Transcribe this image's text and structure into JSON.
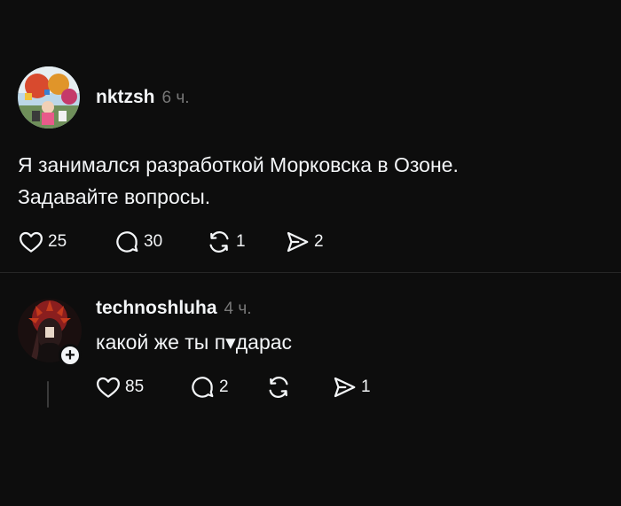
{
  "post": {
    "username": "nktzsh",
    "time": "6 ч.",
    "text_lines": [
      "Я занимался разработкой Морковска в Озоне.",
      "Задавайте вопросы."
    ],
    "likes": "25",
    "comments": "30",
    "reposts": "1",
    "shares": "2"
  },
  "reply": {
    "username": "technoshluha",
    "time": "4 ч.",
    "text": "какой же ты п▾дарас",
    "likes": "85",
    "comments": "2",
    "reposts": "",
    "shares": "1",
    "follow_symbol": "+"
  },
  "icons": {
    "like": "heart-icon",
    "comment": "comment-bubble-icon",
    "repost": "repost-icon",
    "share": "send-icon"
  },
  "colors": {
    "background": "#0d0d0d",
    "text": "#f3f5f7",
    "muted": "#777777",
    "divider": "#262626"
  }
}
